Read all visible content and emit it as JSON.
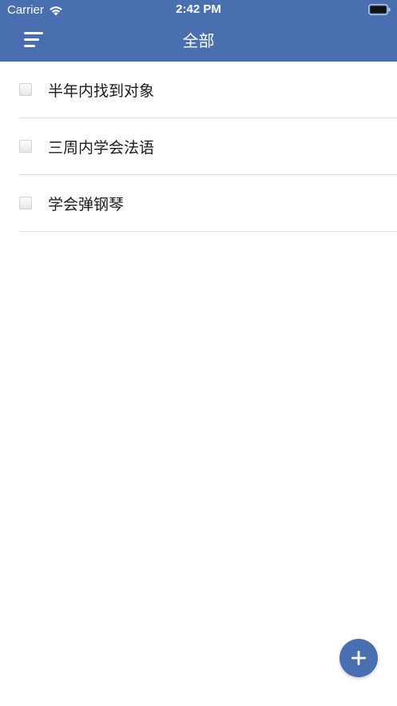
{
  "status_bar": {
    "carrier": "Carrier",
    "time": "2:42 PM"
  },
  "nav": {
    "title": "全部",
    "menu_icon": "hamburger-menu-icon"
  },
  "todos": [
    {
      "label": "半年内找到对象",
      "checked": false
    },
    {
      "label": "三周内学会法语",
      "checked": false
    },
    {
      "label": "学会弹钢琴",
      "checked": false
    }
  ],
  "fab": {
    "icon": "plus-icon"
  },
  "colors": {
    "primary": "#4a6fb0",
    "background": "#ffffff",
    "divider": "#e1e1e1"
  }
}
